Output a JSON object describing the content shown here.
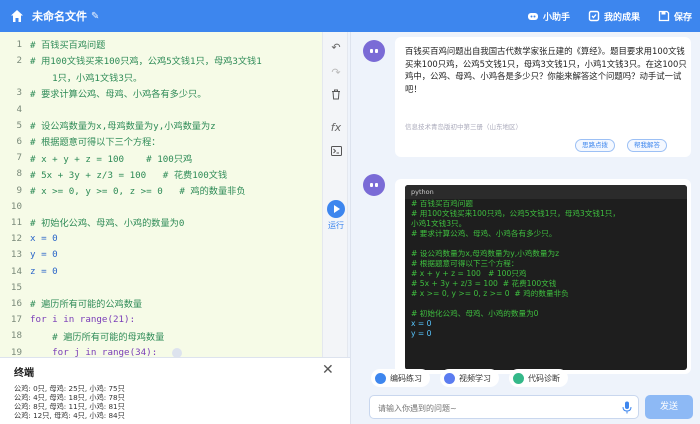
{
  "header": {
    "title": "未命名文件",
    "assistant_label": "小助手",
    "achievements_label": "我的成果",
    "save_label": "保存"
  },
  "editor": {
    "lines": [
      {
        "n": "1",
        "t": "# 百钱买百鸡问题"
      },
      {
        "n": "2",
        "t": "# 用100文钱买来100只鸡，公鸡5文钱1只，母鸡3文钱1"
      },
      {
        "n": "",
        "t": "    1只，小鸡1文钱3只。"
      },
      {
        "n": "3",
        "t": "# 要求计算公鸡、母鸡、小鸡各有多少只。"
      },
      {
        "n": "4",
        "t": ""
      },
      {
        "n": "5",
        "t": "# 设公鸡数量为x,母鸡数量为y,小鸡数量为z"
      },
      {
        "n": "6",
        "t": "# 根据题意可得以下三个方程："
      },
      {
        "n": "7",
        "t": "# x + y + z = 100    # 100只鸡"
      },
      {
        "n": "8",
        "t": "# 5x + 3y + z/3 = 100   # 花费100文钱"
      },
      {
        "n": "9",
        "t": "# x >= 0, y >= 0, z >= 0   # 鸡的数量非负"
      },
      {
        "n": "10",
        "t": ""
      },
      {
        "n": "11",
        "t": "# 初始化公鸡、母鸡、小鸡的数量为0"
      },
      {
        "n": "12",
        "t": "x = 0"
      },
      {
        "n": "13",
        "t": "y = 0"
      },
      {
        "n": "14",
        "t": "z = 0"
      },
      {
        "n": "15",
        "t": ""
      },
      {
        "n": "16",
        "t": "# 遍历所有可能的公鸡数量"
      },
      {
        "n": "17",
        "t": "for i in range(21):"
      },
      {
        "n": "18",
        "t": "    # 遍历所有可能的母鸡数量"
      },
      {
        "n": "19",
        "t": "    for j in range(34):"
      }
    ]
  },
  "toolbar": {
    "run_label": "运行"
  },
  "terminal": {
    "title": "终端",
    "output": "公鸡: 0只, 母鸡: 25只, 小鸡: 75只\n公鸡: 4只, 母鸡: 18只, 小鸡: 78只\n公鸡: 8只, 母鸡: 11只, 小鸡: 81只\n公鸡: 12只, 母鸡: 4只, 小鸡: 84只"
  },
  "chat": {
    "message1": "百钱买百鸡问题出自我国古代数学家张丘建的《算经》。题目要求用100文钱买来100只鸡，公鸡5文钱1只，母鸡3文钱1只，小鸡1文钱3只。在这100只鸡中，公鸡、母鸡、小鸡各是多少只？你能来解答这个问题吗？动手试一试吧！",
    "source": "信息技术青岛版初中第三册（山东地区）",
    "btn_hint": "思路点拨",
    "btn_answer": "帮我解答",
    "code_lang": "python",
    "code_lines": [
      "# 百钱买百鸡问题",
      "# 用100文钱买来100只鸡，公鸡5文钱1只，母鸡3文钱1只，",
      "小鸡1文钱3只。",
      "# 要求计算公鸡、母鸡、小鸡各有多少只。",
      "",
      "# 设公鸡数量为x,母鸡数量为y,小鸡数量为z",
      "# 根据题意可得以下三个方程：",
      "# x + y + z = 100   # 100只鸡",
      "# 5x + 3y + z/3 = 100  # 花费100文钱",
      "# x >= 0, y >= 0, z >= 0  # 鸡的数量非负",
      "",
      "# 初始化公鸡、母鸡、小鸡的数量为0",
      "x = 0",
      "y = 0"
    ],
    "chips": [
      "编码练习",
      "视频学习",
      "代码诊断"
    ],
    "input_placeholder": "请输入你遇到的问题~",
    "send_label": "发送"
  },
  "colors": {
    "brand": "#3d86ee",
    "editor_bg": "#f6fbe7",
    "comment_green": "#2e8b57"
  }
}
